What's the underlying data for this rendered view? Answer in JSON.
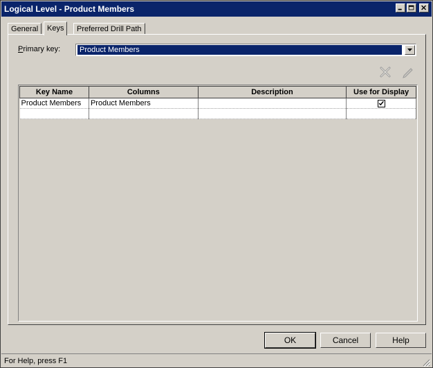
{
  "window": {
    "title": "Logical Level - Product Members"
  },
  "tabs": [
    {
      "label": "General"
    },
    {
      "label": "Keys"
    },
    {
      "label": "Preferred Drill Path"
    }
  ],
  "primary_key": {
    "label_prefix": "P",
    "label_rest": "rimary key:",
    "value": "Product Members"
  },
  "toolbar": {
    "delete_icon": "delete-x-icon",
    "edit_icon": "pencil-edit-icon"
  },
  "keys_table": {
    "columns": [
      "Key Name",
      "Columns",
      "Description",
      "Use for Display"
    ],
    "rows": [
      {
        "key_name": "Product Members",
        "columns": "Product Members",
        "description": "",
        "use_for_display": true
      }
    ]
  },
  "buttons": {
    "ok": "OK",
    "cancel": "Cancel",
    "help": "Help"
  },
  "status": {
    "text": "For Help, press F1"
  },
  "colors": {
    "titlebar": "#0a246a",
    "face": "#d4d0c8",
    "selection": "#0a246a"
  }
}
